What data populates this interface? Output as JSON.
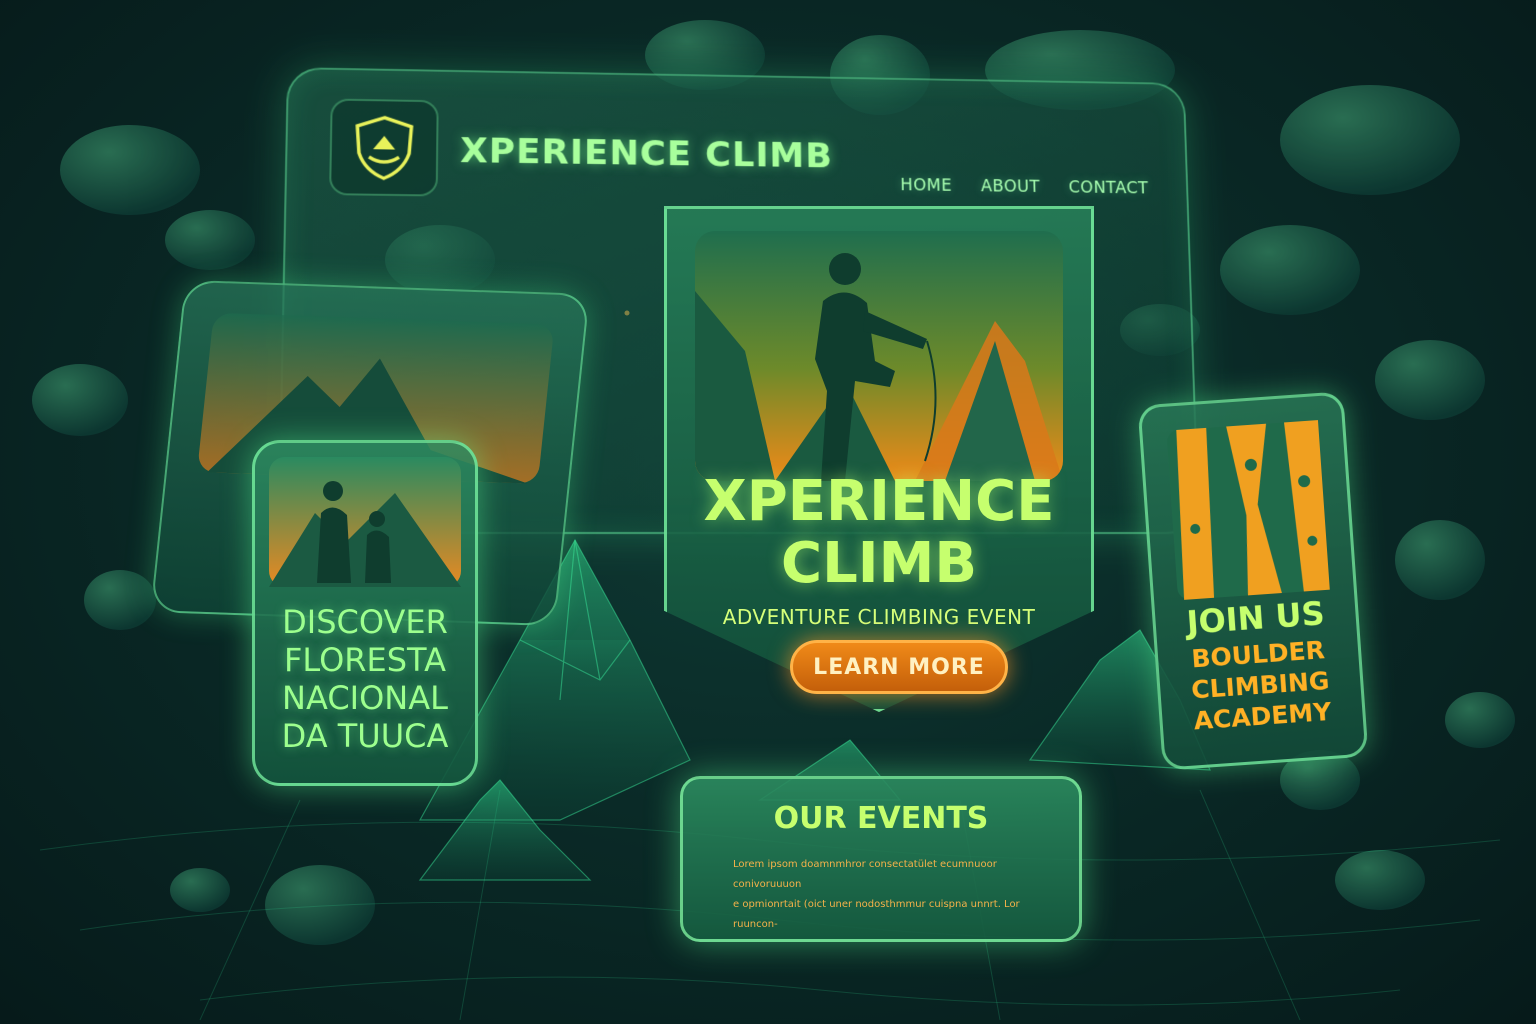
{
  "brand": {
    "name": "XPERIENCE CLIMB"
  },
  "nav": {
    "items": [
      "HOME",
      "ABOUT",
      "CONTACT"
    ]
  },
  "hero": {
    "title_line1": "XPERIENCE",
    "title_line2": "CLIMB",
    "subtitle": "ADVENTURE CLIMBING EVENT",
    "cta": "LEARN MORE"
  },
  "discover_card": {
    "lines": [
      "DISCOVER",
      "FLORESTA",
      "NACIONAL",
      "DA TUUCA"
    ]
  },
  "join_card": {
    "title": "JOIN US",
    "lines": [
      "BOULDER",
      "CLIMBING",
      "ACADEMY"
    ]
  },
  "events": {
    "title": "OUR EVENTS",
    "body_line1": "Lorem ipsom doamnmhror consectatület ecumnuoor conivoruuuon",
    "body_line2": "e opmionrtait (oict uner nodosthmmur cuispna unnrt. Lor ruuncon-"
  },
  "colors": {
    "accent_green": "#a8ff9c",
    "accent_lime": "#c6ff6e",
    "accent_orange": "#f08a18",
    "background": "#0a2a27"
  },
  "icons": {
    "logo": "shield-mountain-icon"
  }
}
